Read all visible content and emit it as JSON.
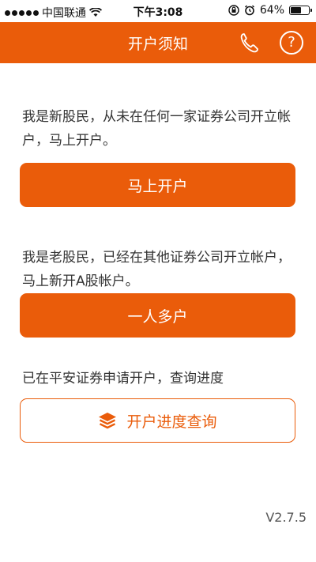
{
  "status": {
    "carrier": "中国联通",
    "time": "下午3:08",
    "battery": "64%",
    "battery_level": 0.64
  },
  "navbar": {
    "title": "开户须知",
    "phone_icon": "phone-icon",
    "help_icon": "help-icon",
    "help_glyph": "?"
  },
  "new_investor": {
    "text": "我是新股民，从未在任何一家证券公司开立帐户，马上开户。",
    "button": "马上开户"
  },
  "old_investor": {
    "text": "我是老股民，已经在其他证券公司开立帐户，马上新开A股帐户。",
    "button": "一人多户"
  },
  "progress": {
    "text": "已在平安证券申请开户，查询进度",
    "button": "开户进度查询",
    "icon": "layers-icon"
  },
  "version": "V2.7.5",
  "colors": {
    "accent": "#ea5c0a"
  }
}
